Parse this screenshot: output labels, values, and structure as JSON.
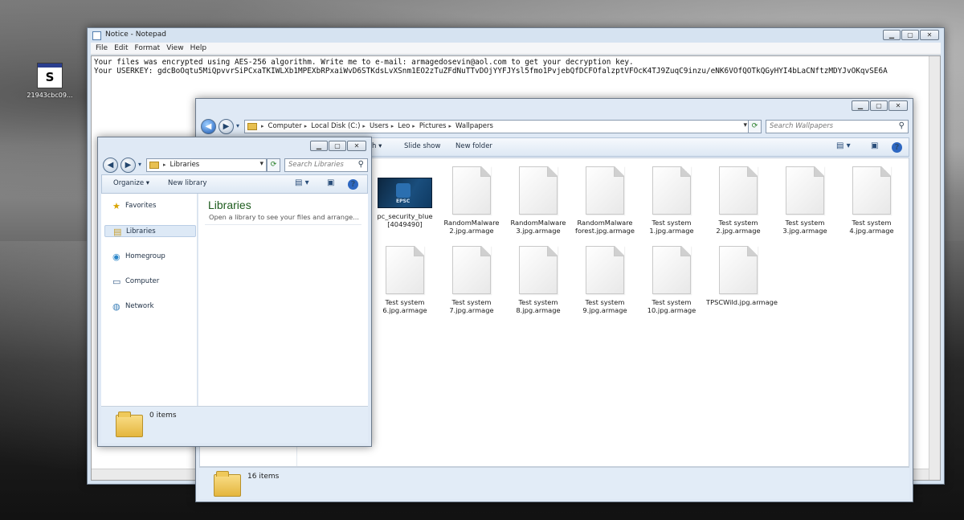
{
  "desktop": {
    "icon_glyph": "S",
    "icon_label": "21943cbc09..."
  },
  "notepad": {
    "title": "Notice - Notepad",
    "menu": [
      "File",
      "Edit",
      "Format",
      "View",
      "Help"
    ],
    "lines": [
      "Your files was encrypted using AES-256 algorithm. Write me to e-mail: armagedosevin@aol.com to get your decryption key.",
      "Your USERKEY: gdcBoOqtu5MiQpvvrSiPCxaTKIWLXb1MPEXbRPxaiWvD6STKdsLvXSnm1EO2zTuZFdNuTTvDOjYYFJYsl5fmo1PvjebQfDCFOfalzptVFOcK4TJ9ZuqC9inzu/eNK6VOfQOTkQGyHYI4bLaCNftzMDYJvOKqvSE6A"
    ]
  },
  "explorer": {
    "breadcrumb": [
      "Computer",
      "Local Disk (C:)",
      "Users",
      "Leo",
      "Pictures",
      "Wallpapers"
    ],
    "search_placeholder": "Search Wallpapers",
    "toolbar": {
      "share_fragment": "h",
      "slideshow": "Slide show",
      "new_folder": "New folder"
    },
    "files": [
      {
        "name": "pc_security_blue [4049490]",
        "thumb": true,
        "thumb_text": "EPSC"
      },
      {
        "name": "RandomMalware 2.jpg.armage"
      },
      {
        "name": "RandomMalware 3.jpg.armage"
      },
      {
        "name": "RandomMalware forest.jpg.armage"
      },
      {
        "name": "Test system 1.jpg.armage"
      },
      {
        "name": "Test system 2.jpg.armage"
      },
      {
        "name": "Test system 3.jpg.armage"
      },
      {
        "name": "Test system 4.jpg.armage"
      },
      {
        "name": "Test system 6.jpg.armage"
      },
      {
        "name": "Test system 7.jpg.armage"
      },
      {
        "name": "Test system 8.jpg.armage"
      },
      {
        "name": "Test system 9.jpg.armage"
      },
      {
        "name": "Test system 10.jpg.armage"
      },
      {
        "name": "TPSCWild.jpg.armage"
      }
    ],
    "status": "16 items"
  },
  "libraries": {
    "address": "Libraries",
    "search_placeholder": "Search Libraries",
    "toolbar": {
      "organize": "Organize",
      "new_library": "New library"
    },
    "nav": [
      {
        "label": "Favorites",
        "icon": "star-icon"
      },
      {
        "label": "Libraries",
        "icon": "libraries-icon",
        "selected": true
      },
      {
        "label": "Homegroup",
        "icon": "homegroup-icon"
      },
      {
        "label": "Computer",
        "icon": "computer-icon"
      },
      {
        "label": "Network",
        "icon": "network-icon"
      }
    ],
    "heading": "Libraries",
    "subheading": "Open a library to see your files and arrange...",
    "status": "0 items"
  }
}
